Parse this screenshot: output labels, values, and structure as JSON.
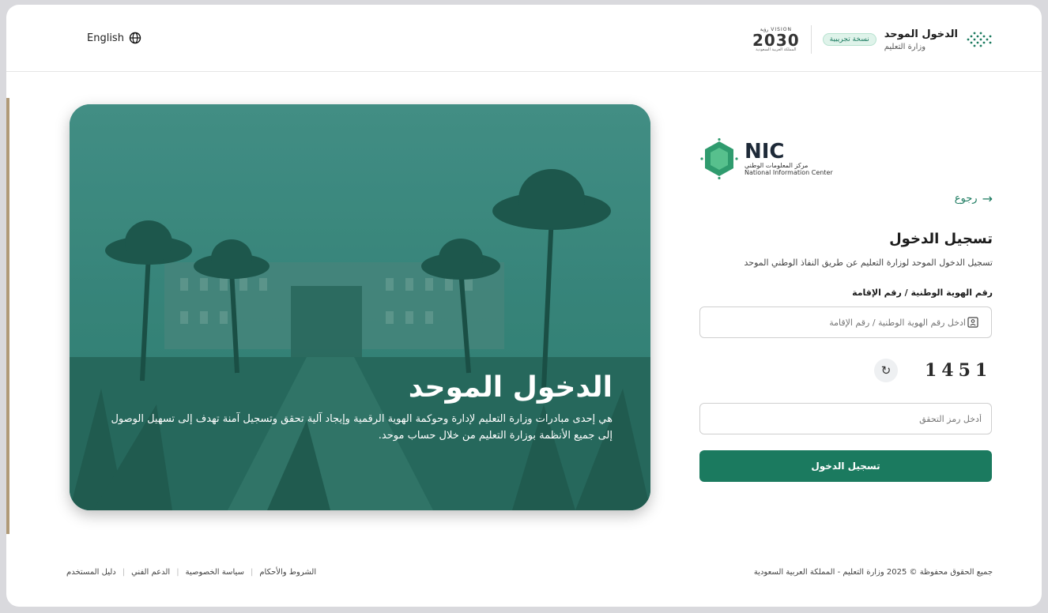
{
  "header": {
    "language_label": "English",
    "brand_title": "الدخول الموحد",
    "brand_subtitle": "وزارة التعليم",
    "beta_badge": "نسخة تجريبية",
    "vision_top": "VISION رؤية",
    "vision_year": "2030",
    "vision_bottom": "المملكة العربية السعودية"
  },
  "hero": {
    "title": "الدخول الموحد",
    "description": "هي إحدى مبادرات وزارة التعليم لإدارة وحوكمة الهوية الرقمية وإيجاد آلية تحقق وتسجيل آمنة تهدف إلى تسهيل الوصول إلى جميع الأنظمة بوزارة التعليم من خلال حساب موحد."
  },
  "nic": {
    "word": "NIC",
    "arabic": "مركز المعلومات الوطني",
    "english": "National Information Center"
  },
  "login": {
    "back_label": "رجوع",
    "title": "تسجيل الدخول",
    "subtitle": "تسجيل الدخول الموحد لوزارة التعليم عن طريق النفاذ الوطني الموحد",
    "id_label": "رقم الهوية الوطنية / رقم الإقامة",
    "id_placeholder": "ادخل رقم الهوية الوطنية / رقم الإقامة",
    "captcha_code": "1451",
    "captcha_placeholder": "أدخل رمز التحقق",
    "submit_label": "تسجيل الدخول"
  },
  "footer": {
    "copyright": "جميع الحقوق محفوظة © 2025 وزارة التعليم - المملكة العربية السعودية",
    "links": [
      "الشروط والأحكام",
      "سياسة الخصوصية",
      "الدعم الفني",
      "دليل المستخدم"
    ]
  },
  "colors": {
    "accent": "#1b7a5f",
    "hero_overlay": "#2c7c70"
  }
}
